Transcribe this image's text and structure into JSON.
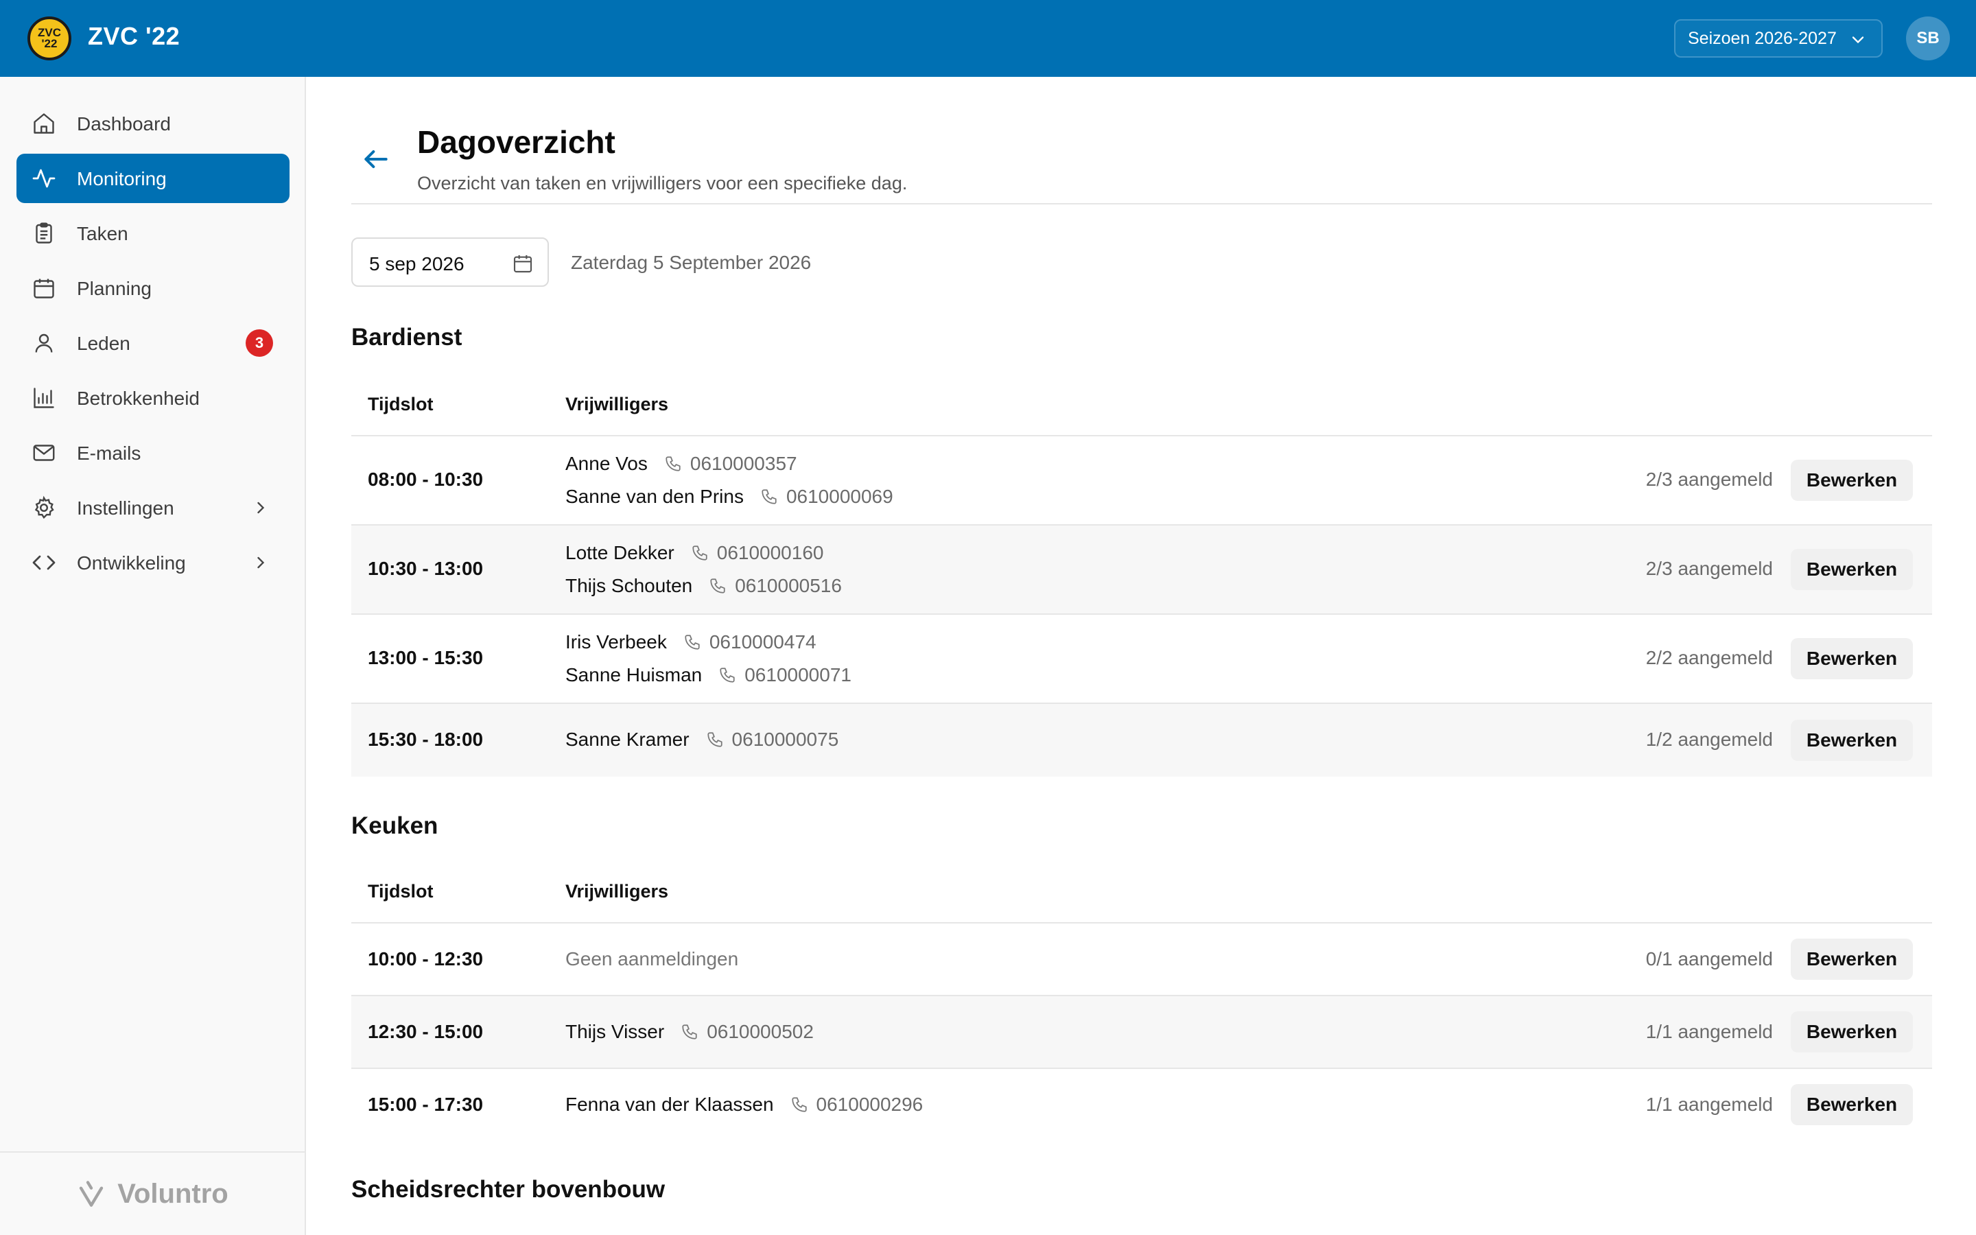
{
  "header": {
    "logo_text": "ZVC '22",
    "app_title": "ZVC '22",
    "season": "Seizoen 2026-2027",
    "avatar_initials": "SB",
    "brand_color": "#0070b3"
  },
  "sidebar": {
    "items": [
      {
        "label": "Dashboard",
        "icon": "home-icon"
      },
      {
        "label": "Monitoring",
        "icon": "activity-icon",
        "active": true
      },
      {
        "label": "Taken",
        "icon": "clipboard-icon"
      },
      {
        "label": "Planning",
        "icon": "calendar-icon"
      },
      {
        "label": "Leden",
        "icon": "user-icon",
        "badge": "3"
      },
      {
        "label": "Betrokkenheid",
        "icon": "bar-chart-icon"
      },
      {
        "label": "E-mails",
        "icon": "mail-icon"
      },
      {
        "label": "Instellingen",
        "icon": "gear-icon",
        "expandable": true
      },
      {
        "label": "Ontwikkeling",
        "icon": "code-icon",
        "expandable": true
      }
    ],
    "footer_brand": "Voluntro"
  },
  "page": {
    "title": "Dagoverzicht",
    "subtitle": "Overzicht van taken en vrijwilligers voor een specifieke dag.",
    "date_value": "5 sep 2026",
    "date_long": "Zaterdag 5 September 2026"
  },
  "columns": {
    "slot": "Tijdslot",
    "volunteers": "Vrijwilligers"
  },
  "edit_label": "Bewerken",
  "sections": [
    {
      "title": "Bardienst",
      "rows": [
        {
          "slot": "08:00 - 10:30",
          "volunteers": [
            {
              "name": "Anne Vos",
              "phone": "0610000357"
            },
            {
              "name": "Sanne van den Prins",
              "phone": "0610000069"
            }
          ],
          "count": "2/3 aangemeld"
        },
        {
          "slot": "10:30 - 13:00",
          "volunteers": [
            {
              "name": "Lotte Dekker",
              "phone": "0610000160"
            },
            {
              "name": "Thijs Schouten",
              "phone": "0610000516"
            }
          ],
          "count": "2/3 aangemeld"
        },
        {
          "slot": "13:00 - 15:30",
          "volunteers": [
            {
              "name": "Iris Verbeek",
              "phone": "0610000474"
            },
            {
              "name": "Sanne Huisman",
              "phone": "0610000071"
            }
          ],
          "count": "2/2 aangemeld"
        },
        {
          "slot": "15:30 - 18:00",
          "volunteers": [
            {
              "name": "Sanne Kramer",
              "phone": "0610000075"
            }
          ],
          "count": "1/2 aangemeld"
        }
      ]
    },
    {
      "title": "Keuken",
      "rows": [
        {
          "slot": "10:00 - 12:30",
          "volunteers": [],
          "empty_text": "Geen aanmeldingen",
          "count": "0/1 aangemeld"
        },
        {
          "slot": "12:30 - 15:00",
          "volunteers": [
            {
              "name": "Thijs Visser",
              "phone": "0610000502"
            }
          ],
          "count": "1/1 aangemeld"
        },
        {
          "slot": "15:00 - 17:30",
          "volunteers": [
            {
              "name": "Fenna van der Klaassen",
              "phone": "0610000296"
            }
          ],
          "count": "1/1 aangemeld"
        }
      ]
    },
    {
      "title": "Scheidsrechter bovenbouw",
      "rows": []
    }
  ]
}
